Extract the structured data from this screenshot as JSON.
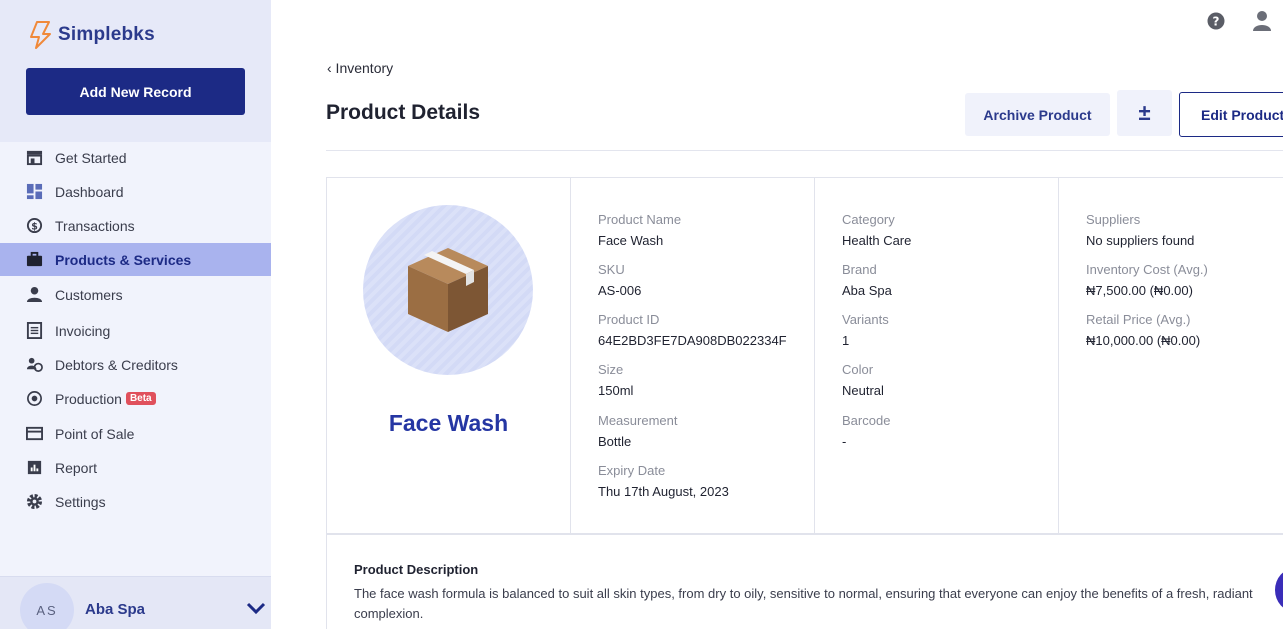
{
  "brand": {
    "name": "Simplebks",
    "accent": "#1c2a85",
    "logo_color": "#f0893a"
  },
  "sidebar": {
    "add_button": "Add New Record",
    "items": [
      {
        "label": "Get Started",
        "icon": "store-icon"
      },
      {
        "label": "Dashboard",
        "icon": "dashboard-icon"
      },
      {
        "label": "Transactions",
        "icon": "transactions-icon"
      },
      {
        "label": "Products & Services",
        "icon": "briefcase-icon",
        "active": true
      },
      {
        "label": "Customers",
        "icon": "person-icon"
      },
      {
        "label": "Invoicing",
        "icon": "invoice-icon"
      },
      {
        "label": "Debtors & Creditors",
        "icon": "debtors-icon"
      },
      {
        "label": "Production",
        "icon": "production-icon",
        "badge": "Beta"
      },
      {
        "label": "Point of Sale",
        "icon": "card-icon"
      },
      {
        "label": "Report",
        "icon": "report-icon"
      },
      {
        "label": "Settings",
        "icon": "gear-icon"
      }
    ],
    "account": {
      "initials": "AS",
      "name": "Aba Spa"
    }
  },
  "header": {
    "breadcrumb": "‹ Inventory",
    "title": "Product Details",
    "archive_button": "Archive Product",
    "adjust_button": "±",
    "edit_button": "Edit Product"
  },
  "product": {
    "name": "Face Wash",
    "details_a": [
      {
        "label": "Product Name",
        "value": "Face Wash"
      },
      {
        "label": "SKU",
        "value": "AS-006"
      },
      {
        "label": "Product ID",
        "value": "64E2BD3FE7DA908DB022334F"
      },
      {
        "label": "Size",
        "value": "150ml"
      },
      {
        "label": "Measurement",
        "value": "Bottle"
      },
      {
        "label": "Expiry Date",
        "value": "Thu 17th August, 2023"
      }
    ],
    "details_b": [
      {
        "label": "Category",
        "value": "Health Care"
      },
      {
        "label": "Brand",
        "value": "Aba Spa"
      },
      {
        "label": "Variants",
        "value": "1"
      },
      {
        "label": "Color",
        "value": "Neutral"
      },
      {
        "label": "Barcode",
        "value": "-"
      }
    ],
    "details_c": [
      {
        "label": "Suppliers",
        "value": "No suppliers found"
      },
      {
        "label": "Inventory Cost (Avg.)",
        "value": "₦7,500.00 (₦0.00)"
      },
      {
        "label": "Retail Price (Avg.)",
        "value": "₦10,000.00 (₦0.00)"
      }
    ],
    "description_title": "Product Description",
    "description": "The face wash formula is balanced to suit all skin types, from dry to oily, sensitive to normal, ensuring that everyone can enjoy the benefits of a fresh, radiant complexion."
  }
}
